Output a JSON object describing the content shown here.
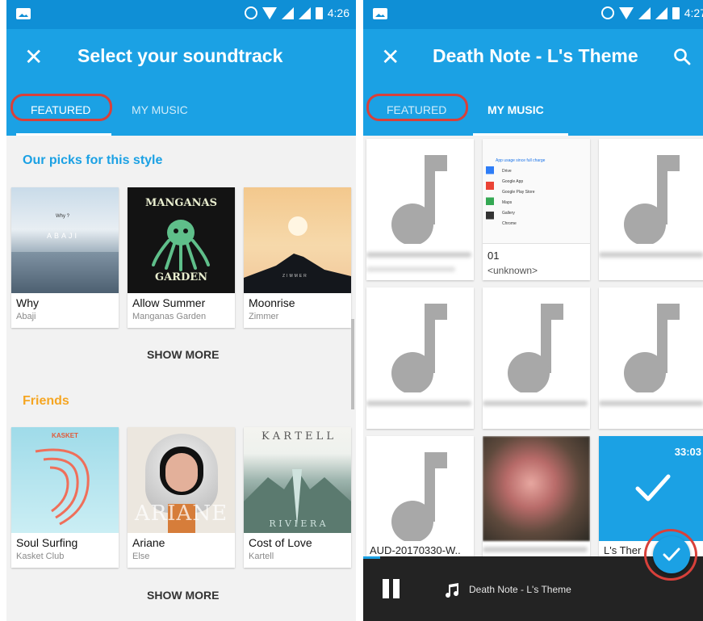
{
  "left": {
    "status_time": "4:26",
    "title": "Select your soundtrack",
    "tabs": [
      {
        "label": "FEATURED",
        "selected": true
      },
      {
        "label": "MY MUSIC",
        "selected": false
      }
    ],
    "sections": [
      {
        "title": "Our picks for this style",
        "title_color": "#1ba1e4",
        "albums": [
          {
            "name": "Why",
            "artist": "Abaji",
            "art_text": "ABAJI",
            "art_small_text": "Why ?"
          },
          {
            "name": "Allow Summer",
            "artist": "Manganas Garden",
            "art_text_top": "MANGANAS",
            "art_text_bottom": "GARDEN"
          },
          {
            "name": "Moonrise",
            "artist": "Zimmer",
            "art_text": "ZIMMER"
          }
        ],
        "show_more": "SHOW MORE"
      },
      {
        "title": "Friends",
        "title_color": "#f5a623",
        "albums": [
          {
            "name": "Soul Surfing",
            "artist": "Kasket Club",
            "art_text": "KASKET"
          },
          {
            "name": "Ariane",
            "artist": "Else",
            "art_text": "ARIANE"
          },
          {
            "name": "Cost of Love",
            "artist": "Kartell",
            "art_text_top": "K A R T E L L",
            "art_text_bottom": "R I V I E R A"
          }
        ],
        "show_more": "SHOW MORE"
      }
    ]
  },
  "right": {
    "status_time": "4:27",
    "title": "Death Note - L's Theme",
    "tabs": [
      {
        "label": "FEATURED",
        "selected": false
      },
      {
        "label": "MY MUSIC",
        "selected": true
      }
    ],
    "tiles": [
      {
        "type": "note",
        "title": ""
      },
      {
        "type": "screenshot",
        "title": "01",
        "subtitle": "<unknown>",
        "shot_rows": [
          "Drive",
          "Google App",
          "Google Play Store",
          "Maps",
          "Gallery",
          "Chrome"
        ],
        "shot_header": "App usage since full charge"
      },
      {
        "type": "note",
        "title": ""
      },
      {
        "type": "note",
        "title": ""
      },
      {
        "type": "note",
        "title": ""
      },
      {
        "type": "note",
        "title": ""
      },
      {
        "type": "note",
        "title": "AUD-20170330-W.."
      },
      {
        "type": "photo",
        "title": ""
      },
      {
        "type": "selected",
        "title": "L's Ther",
        "duration": "33:03"
      }
    ],
    "player": {
      "track": "Death Note - L's Theme",
      "progress": 0.05
    }
  },
  "colors": {
    "statusbar": "#0f8fd6",
    "toolbar": "#1ba1e4",
    "highlight_circle": "#d8403a",
    "player_bg": "#232323"
  }
}
